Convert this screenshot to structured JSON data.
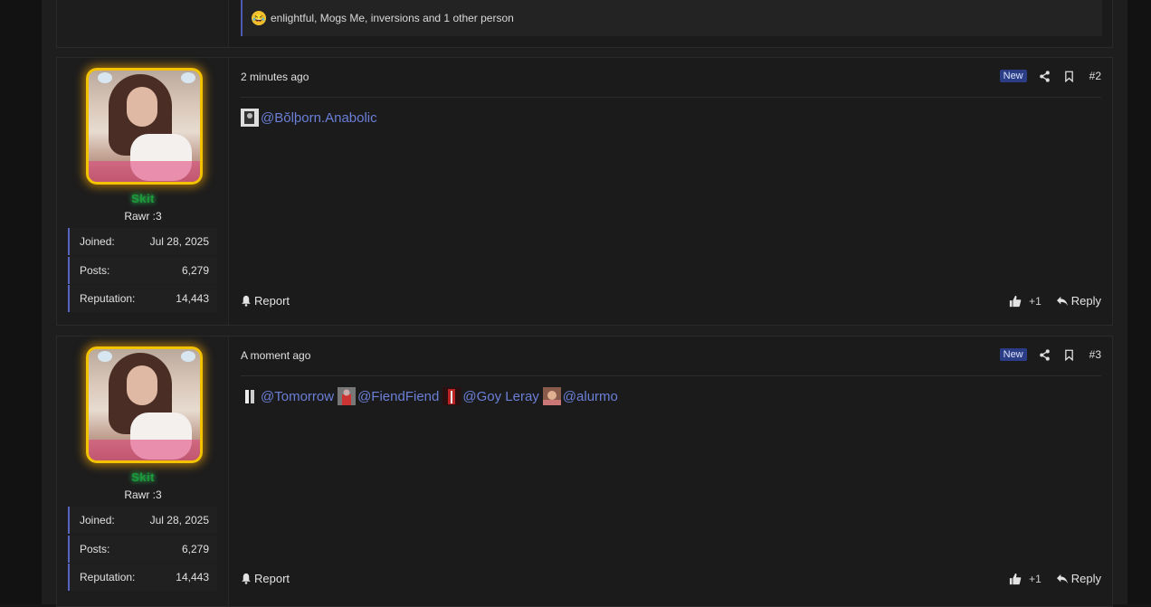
{
  "top_post": {
    "reactions_text": "enlightful, Mogs Me, inversions and 1 other person",
    "reaction_emoji": "laughing-emoji"
  },
  "posts": [
    {
      "username": "Skit",
      "user_title": "Rawr :3",
      "stats": [
        {
          "label": "Joined:",
          "value": "Jul 28, 2025"
        },
        {
          "label": "Posts:",
          "value": "6,279"
        },
        {
          "label": "Reputation:",
          "value": "14,443"
        }
      ],
      "time": "2 minutes ago",
      "badge": "New",
      "post_number": "#2",
      "mentions": [
        "@Bŏlþorn.Anabolic"
      ],
      "report_label": "Report",
      "like_count": "+1",
      "reply_label": "Reply"
    },
    {
      "username": "Skit",
      "user_title": "Rawr :3",
      "stats": [
        {
          "label": "Joined:",
          "value": "Jul 28, 2025"
        },
        {
          "label": "Posts:",
          "value": "6,279"
        },
        {
          "label": "Reputation:",
          "value": "14,443"
        }
      ],
      "time": "A moment ago",
      "badge": "New",
      "post_number": "#3",
      "mentions": [
        "@Tomorrow",
        "@FiendFiend",
        "@Goy Leray",
        "@alurmo"
      ],
      "report_label": "Report",
      "like_count": "+1",
      "reply_label": "Reply"
    }
  ],
  "colors": {
    "accent": "#5865c0",
    "mention": "#6b7fd7",
    "username_glow": "#1d9b3a",
    "avatar_border": "#f3c200",
    "badge_new": "#2a3d86"
  },
  "icons": {
    "share": "share-icon",
    "bookmark": "bookmark-icon",
    "report": "bell-icon",
    "like": "thumbs-up-icon",
    "reply": "reply-icon"
  }
}
